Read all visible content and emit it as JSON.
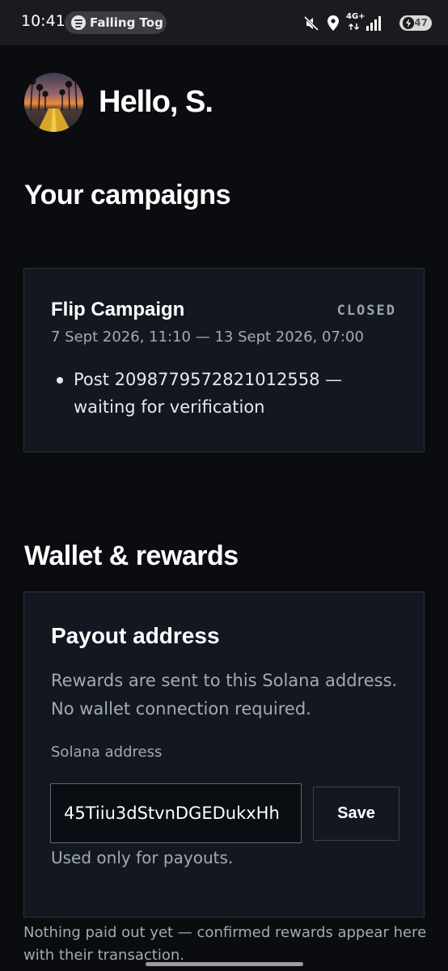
{
  "status_bar": {
    "time": "10:41",
    "now_playing": "Falling Tog",
    "network_type": "4G+",
    "battery_level": "47",
    "icons": [
      "spotify-icon",
      "mute-icon",
      "location-icon",
      "data-arrows-icon",
      "signal-icon",
      "battery-icon"
    ]
  },
  "header": {
    "greeting": "Hello, S."
  },
  "campaigns": {
    "title": "Your campaigns",
    "items": [
      {
        "name": "Flip Campaign",
        "status": "CLOSED",
        "dates": "7 Sept 2026, 11:10 — 13 Sept 2026, 07:00",
        "posts": [
          "Post 2098779572821012558 — waiting for verification"
        ]
      }
    ]
  },
  "wallet": {
    "title": "Wallet & rewards",
    "payout": {
      "title": "Payout address",
      "description": "Rewards are sent to this Solana address. No wallet connection required.",
      "field_label": "Solana address",
      "address_value": "45Tiiu3dStvnDGEDukxHh",
      "save_label": "Save",
      "hint": "Used only for payouts."
    },
    "footer_note": "Nothing paid out yet — confirmed rewards appear here with their transaction."
  },
  "colors": {
    "background": "#0a0c10",
    "card": "#131820",
    "border": "#2b333d",
    "muted_text": "#a2aab3"
  }
}
